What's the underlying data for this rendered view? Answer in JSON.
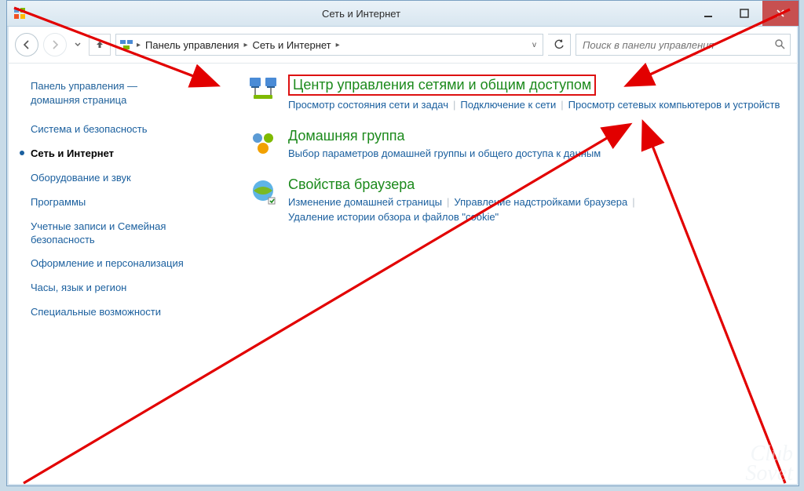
{
  "window": {
    "title": "Сеть и Интернет"
  },
  "breadcrumb": {
    "seg1": "Панель управления",
    "seg2": "Сеть и Интернет"
  },
  "search": {
    "placeholder": "Поиск в панели управления"
  },
  "sidebar": {
    "home_line1": "Панель управления —",
    "home_line2": "домашняя страница",
    "items": [
      "Система и безопасность",
      "Сеть и Интернет",
      "Оборудование и звук",
      "Программы",
      "Учетные записи и Семейная безопасность",
      "Оформление и персонализация",
      "Часы, язык и регион",
      "Специальные возможности"
    ],
    "current_index": 1
  },
  "categories": [
    {
      "title": "Центр управления сетями и общим доступом",
      "links": [
        "Просмотр состояния сети и задач",
        "Подключение к сети",
        "Просмотр сетевых компьютеров и устройств"
      ],
      "highlight": true,
      "icon": "network"
    },
    {
      "title": "Домашняя группа",
      "links": [
        "Выбор параметров домашней группы и общего доступа к данным"
      ],
      "icon": "homegroup"
    },
    {
      "title": "Свойства браузера",
      "links": [
        "Изменение домашней страницы",
        "Управление надстройками браузера",
        "Удаление истории обзора и файлов \"cookie\""
      ],
      "icon": "internet"
    }
  ],
  "watermark": "Sovet\nClub"
}
